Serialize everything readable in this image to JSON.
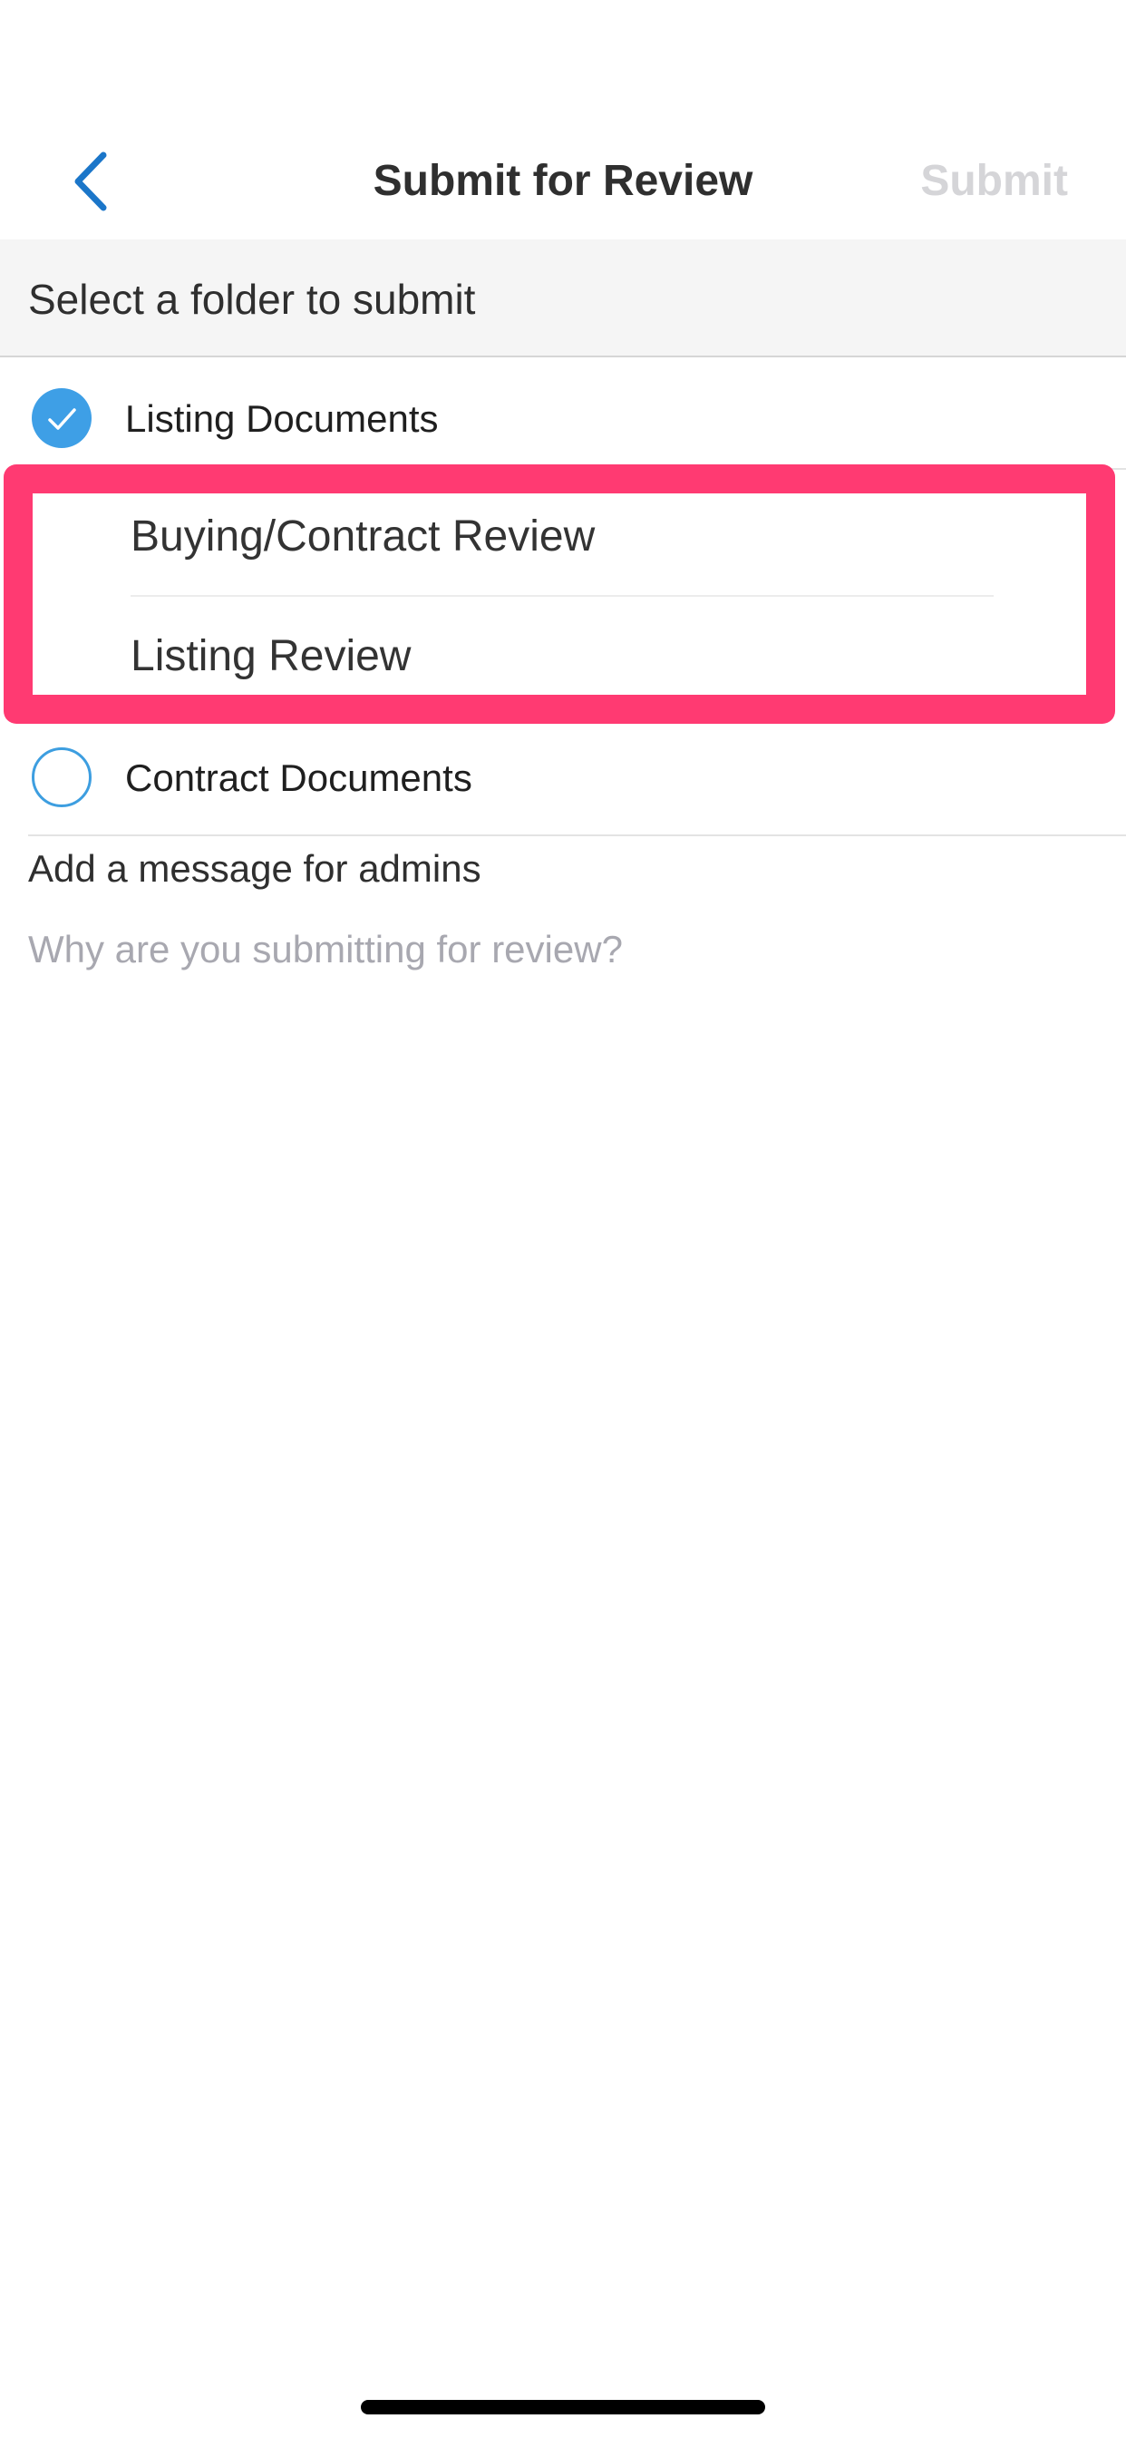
{
  "nav": {
    "title": "Submit for Review",
    "submit_label": "Submit",
    "back_icon": "chevron-left-icon"
  },
  "section": {
    "header": "Select a folder to submit"
  },
  "folders": [
    {
      "label": "Listing Documents",
      "selected": true,
      "subfolders": [
        {
          "label": "Buying/Contract Review"
        },
        {
          "label": "Listing Review"
        }
      ]
    },
    {
      "label": "Contract Documents",
      "selected": false
    }
  ],
  "message": {
    "label": "Add a message for admins",
    "placeholder": "Why are you submitting for review?"
  },
  "colors": {
    "accent": "#3e9fe6",
    "back_chevron": "#1b76c9",
    "submit_disabled": "#d5d5d8",
    "highlight": "#ff3a72",
    "placeholder": "#a8a8b0"
  }
}
